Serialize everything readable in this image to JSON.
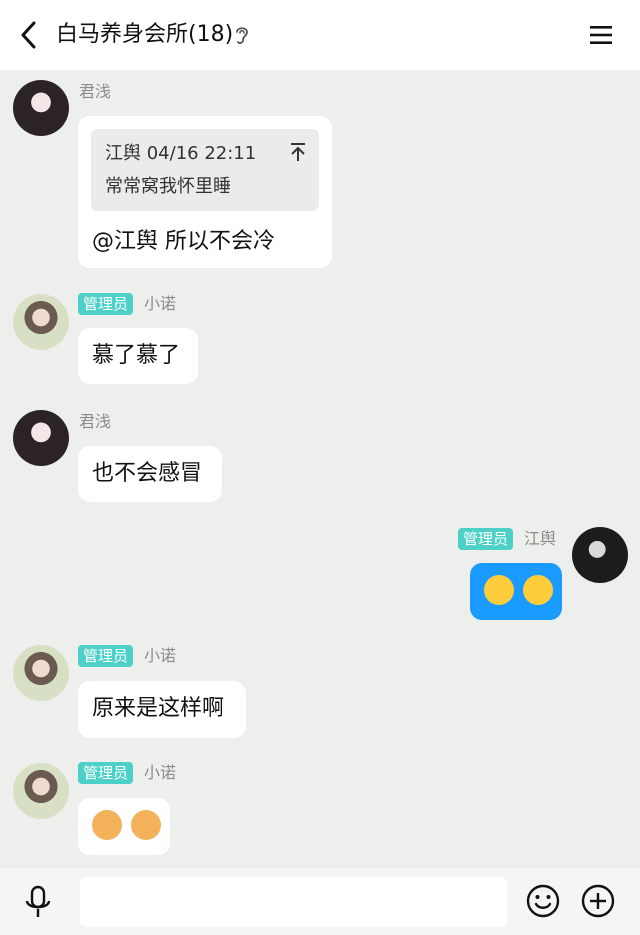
{
  "header": {
    "title": "白马养身会所(18)",
    "back_icon": "chevron-left-icon",
    "ear_icon": "ear-icon",
    "menu_icon": "menu-icon"
  },
  "messages": [
    {
      "sender": "君浅",
      "badge": "",
      "quote": {
        "author_time": "江舆 04/16 22:11",
        "text": "常常窝我怀里睡"
      },
      "text": "@江舆 所以不会冷"
    },
    {
      "sender": "小诺",
      "badge": "管理员",
      "text": "慕了慕了"
    },
    {
      "sender": "君浅",
      "badge": "",
      "text": "也不会感冒"
    },
    {
      "sender": "江舆",
      "badge": "管理员",
      "text": "😂😂",
      "mine": true
    },
    {
      "sender": "小诺",
      "badge": "管理员",
      "text": "原来是这样啊"
    },
    {
      "sender": "小诺",
      "badge": "管理员",
      "text": "🐶🐶"
    }
  ],
  "composer": {
    "placeholder": "",
    "mic_icon": "microphone-icon",
    "emoji_icon": "smiley-icon",
    "plus_icon": "plus-circle-icon"
  },
  "colors": {
    "background": "#ecefec",
    "badge": "#4dd0c8",
    "mine_bubble": "#1a9bff"
  }
}
